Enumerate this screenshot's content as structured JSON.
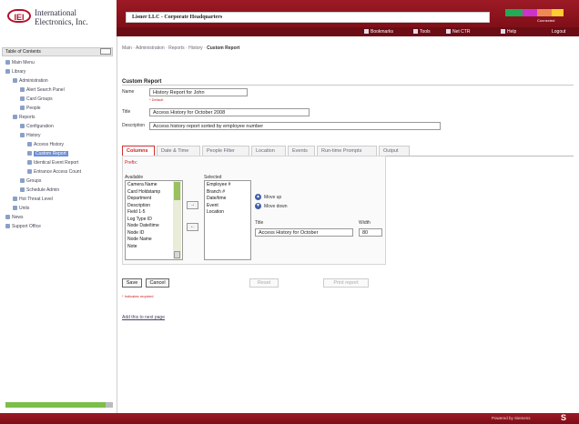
{
  "brand": {
    "logo": "IEI",
    "line1": "International",
    "line2": "Electronics, Inc."
  },
  "window_title": "Lisner LLC - Corporate Headquarters",
  "status_label": "Connected",
  "menu": [
    {
      "label": "Bookmarks",
      "icon": "bookmark-icon"
    },
    {
      "label": "Tools",
      "icon": "tools-icon"
    },
    {
      "label": "Net CTR",
      "icon": "network-icon"
    },
    {
      "label": "Help",
      "icon": "help-icon"
    },
    {
      "label": "Logout",
      "icon": ""
    }
  ],
  "sidebar": {
    "header": "Table of Contents",
    "nodes": [
      {
        "label": "Main Menu",
        "level": 0
      },
      {
        "label": "Library",
        "level": 0
      },
      {
        "label": "Administration",
        "level": 1
      },
      {
        "label": "Alert Search Panel",
        "level": 2
      },
      {
        "label": "Card Groups",
        "level": 2
      },
      {
        "label": "People",
        "level": 2
      },
      {
        "label": "Reports",
        "level": 1
      },
      {
        "label": "Configuration",
        "level": 2
      },
      {
        "label": "History",
        "level": 2
      },
      {
        "label": "Access History",
        "level": 3
      },
      {
        "label": "Custom Report",
        "level": 3,
        "selected": true
      },
      {
        "label": "Identical Event Report",
        "level": 3
      },
      {
        "label": "Entrance Access Count",
        "level": 3
      },
      {
        "label": "Groups",
        "level": 2
      },
      {
        "label": "Schedule Admin",
        "level": 2
      },
      {
        "label": "Hot Threat Level",
        "level": 1
      },
      {
        "label": "Units",
        "level": 1
      },
      {
        "label": "News",
        "level": 0
      },
      {
        "label": "Support Office",
        "level": 0
      }
    ]
  },
  "breadcrumb": [
    "Main",
    "Administration",
    "Reports",
    "History",
    "Custom Report"
  ],
  "form": {
    "section_title": "Custom Report",
    "name_label": "Name",
    "name_value": "History Report for John",
    "required_note": "* Default",
    "title_label": "Title",
    "title_value": "Access History for October 2008",
    "description_label": "Description",
    "description_value": "Access history report sorted by employee number"
  },
  "tabs": [
    "Columns",
    "Date & Time",
    "People Filter",
    "Location",
    "Events",
    "Run-time Prompts",
    "Output"
  ],
  "columns_tab": {
    "prefix_label": "Prefix:",
    "available_label": "Available",
    "selected_label": "Selected",
    "available": [
      "Camera Name",
      "Card Holdstamp",
      "Department",
      "Description",
      "Field 1-5",
      "Log Type ID",
      "Node Date/time",
      "Node ID",
      "Node Name",
      "Note"
    ],
    "selected": [
      "Employee #",
      "Branch #",
      "Date/time",
      "Event",
      "Location"
    ],
    "move_right": "→",
    "move_left": "←",
    "move_up": "Move up",
    "move_down": "Move down",
    "title_label": "Title",
    "width_label": "Width",
    "title_value": "Access History for October",
    "width_value": "80"
  },
  "buttons": {
    "save": "Save",
    "cancel": "Cancel",
    "reset": "Reset",
    "print": "Print report"
  },
  "indicates_required": "* Indicates required",
  "add_link": "Add this to next page",
  "footer": {
    "text": "Powered by Siemens",
    "logo": "S"
  }
}
